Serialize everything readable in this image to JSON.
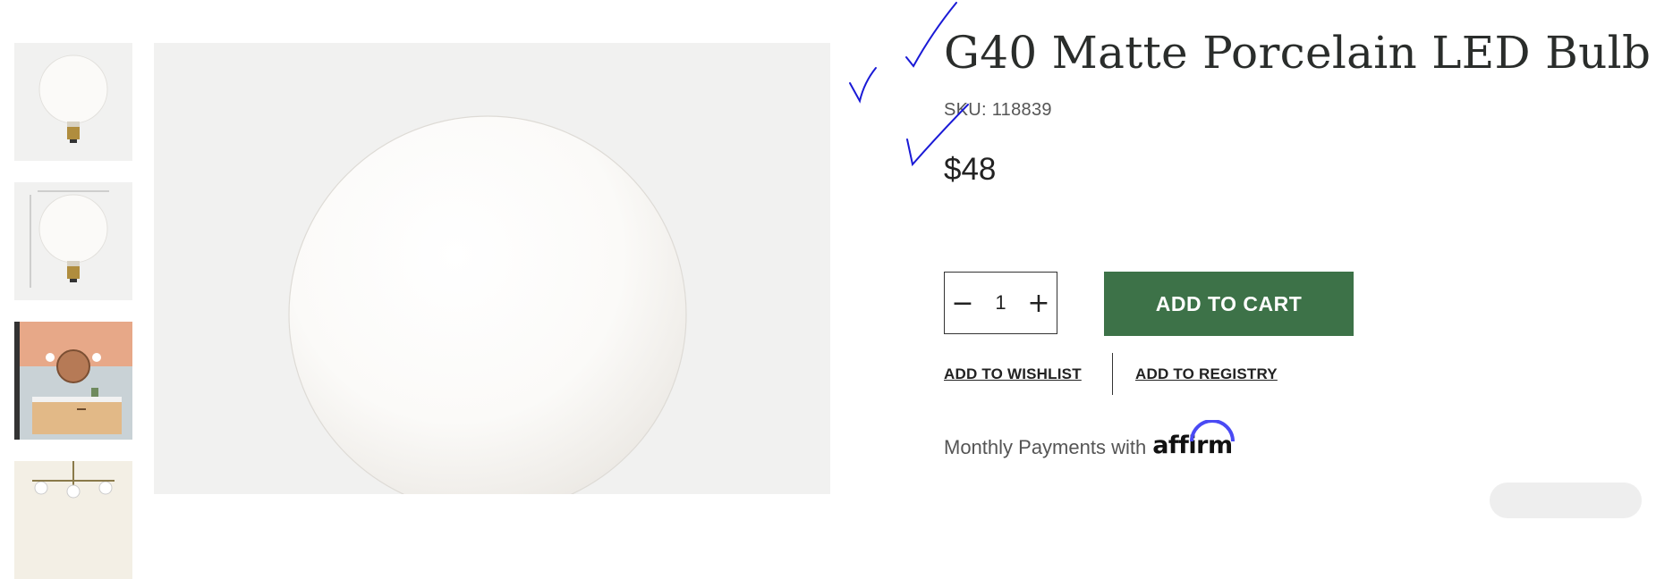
{
  "product": {
    "title": "G40 Matte Porcelain LED Bulb",
    "sku": "SKU: 118839",
    "price": "$48"
  },
  "gallery": {
    "thumbnails": [
      {
        "name": "bulb-front"
      },
      {
        "name": "bulb-dimensions"
      },
      {
        "name": "bathroom-scene"
      },
      {
        "name": "chandelier-scene"
      }
    ]
  },
  "quantity": {
    "minus_symbol": "−",
    "value": "1",
    "plus_symbol": "+"
  },
  "actions": {
    "add_to_cart": "ADD TO CART",
    "add_to_wishlist": "ADD TO WISHLIST",
    "add_to_registry": "ADD TO REGISTRY"
  },
  "payments": {
    "monthly_text": "Monthly Payments with",
    "affirm_logo": "affirm"
  },
  "colors": {
    "cart_green": "#3d7248",
    "annotation_blue": "#1a1ad6",
    "image_bg": "#f1f1f0"
  }
}
